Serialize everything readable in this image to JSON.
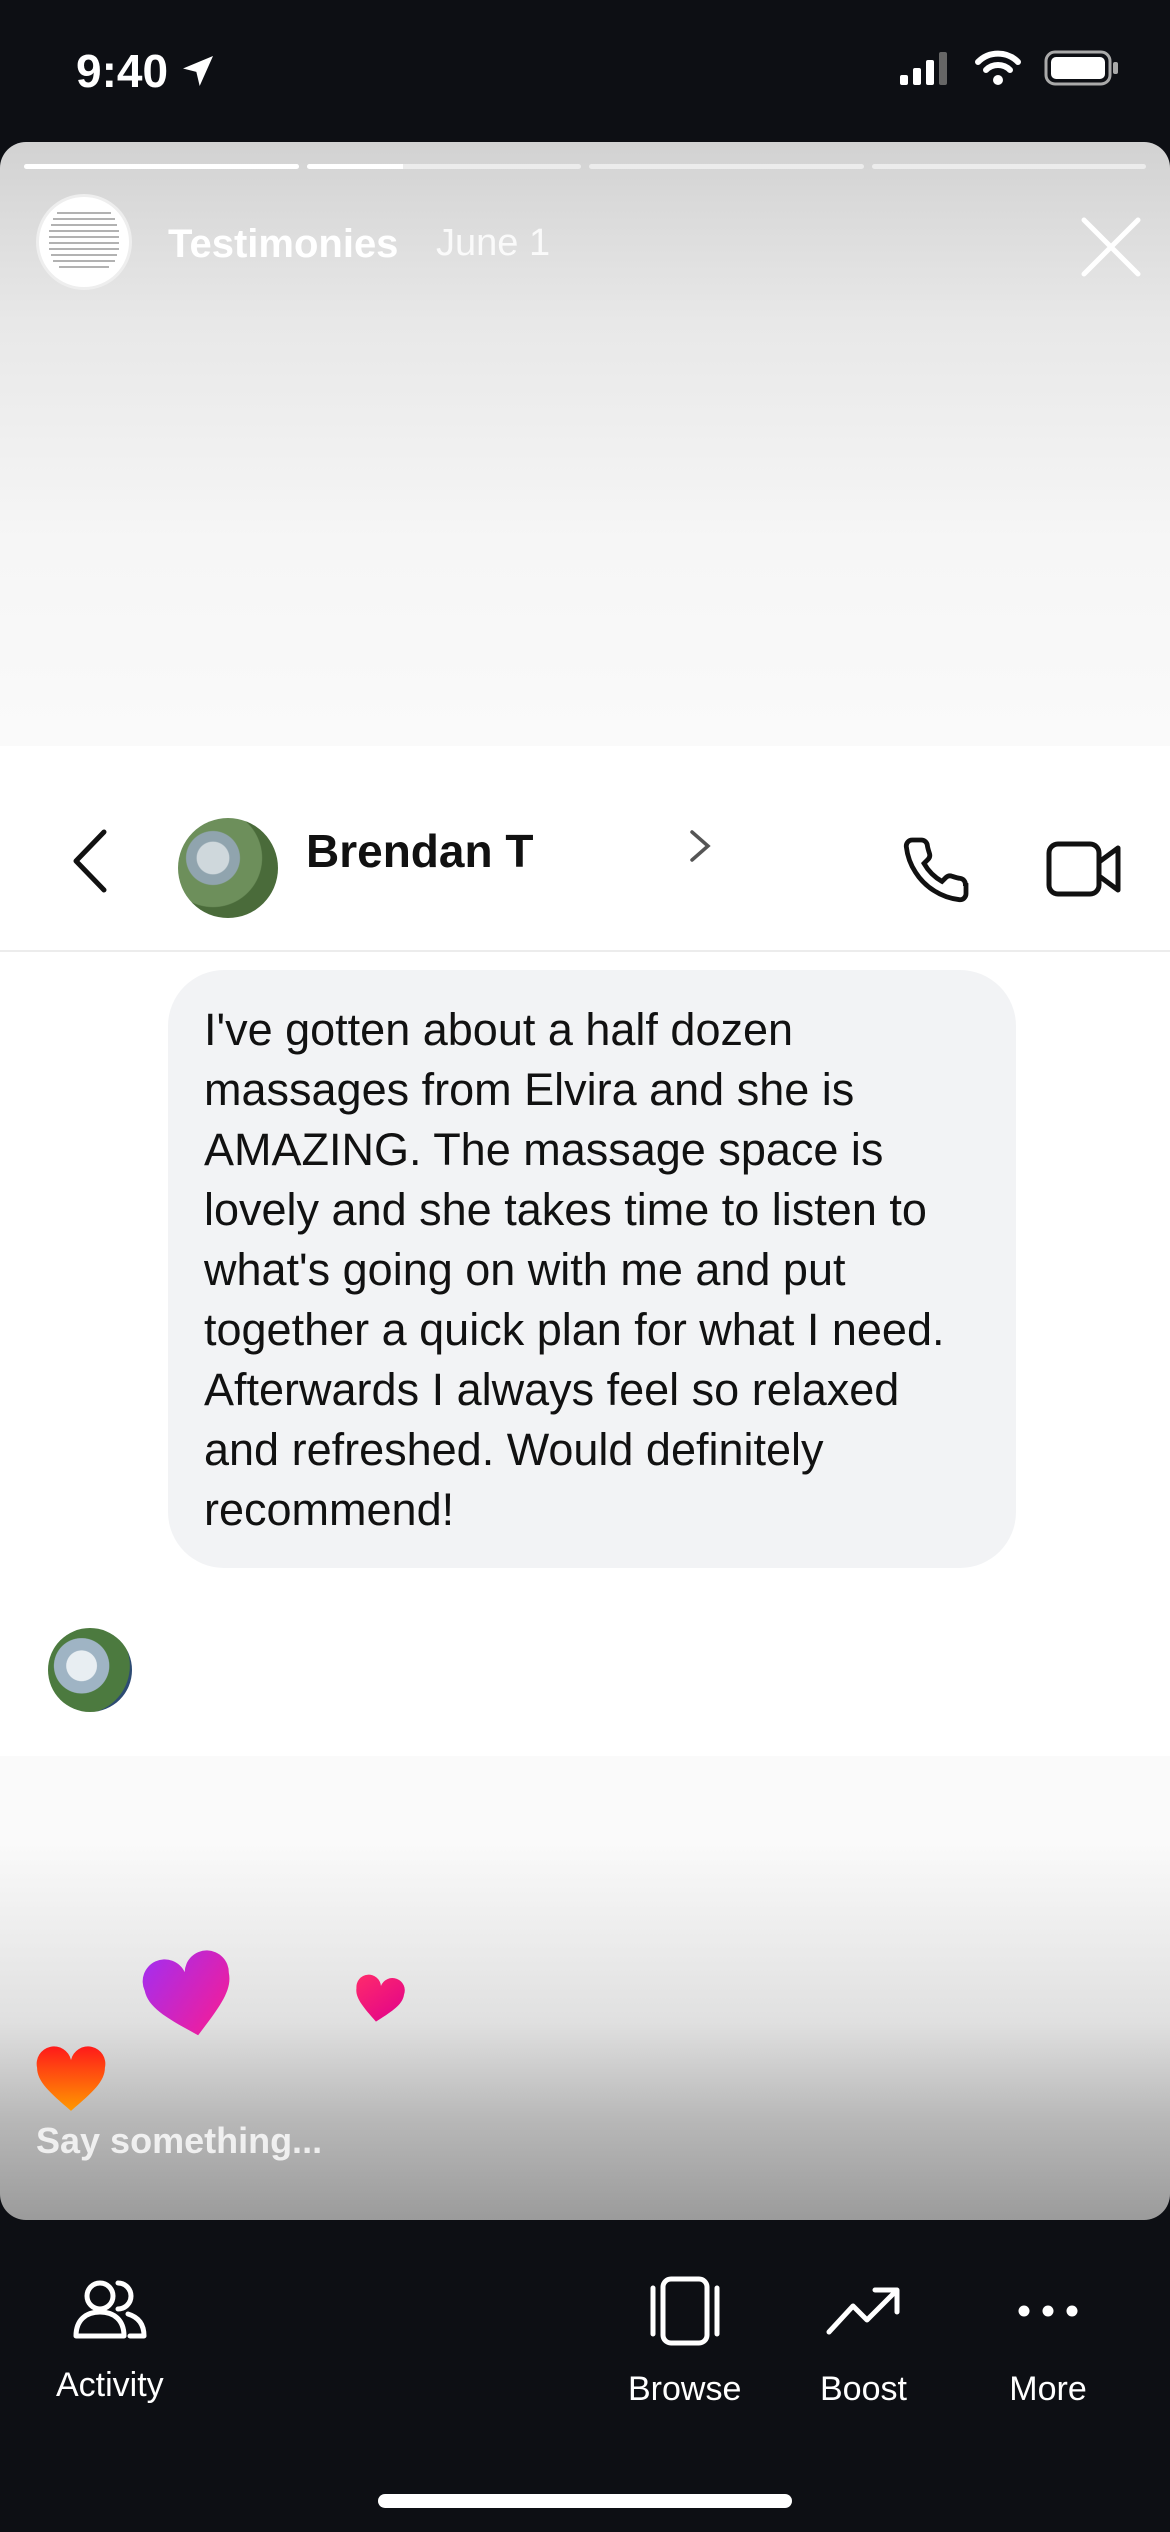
{
  "status_bar": {
    "time": "9:40"
  },
  "story": {
    "progress": [
      1,
      0.35,
      0,
      0
    ],
    "title": "Testimonies",
    "date": "June 1",
    "reply_placeholder": "Say something..."
  },
  "conversation": {
    "contact_name": "Brendan T",
    "message": "I've gotten about a half dozen massages from Elvira and she is AMAZING. The massage space is lovely and she takes time to listen to what's going on with me and put together a quick plan for what I need. Afterwards I always feel so relaxed and refreshed. Would definitely recommend!"
  },
  "toolbar": {
    "activity": "Activity",
    "browse": "Browse",
    "boost": "Boost",
    "more": "More"
  },
  "colors": {
    "background": "#0d0f14",
    "bubble": "#f2f3f5",
    "heart_gradient": [
      "#ff1a1a",
      "#ff9900",
      "#b72cf0",
      "#ff1a8c"
    ]
  }
}
